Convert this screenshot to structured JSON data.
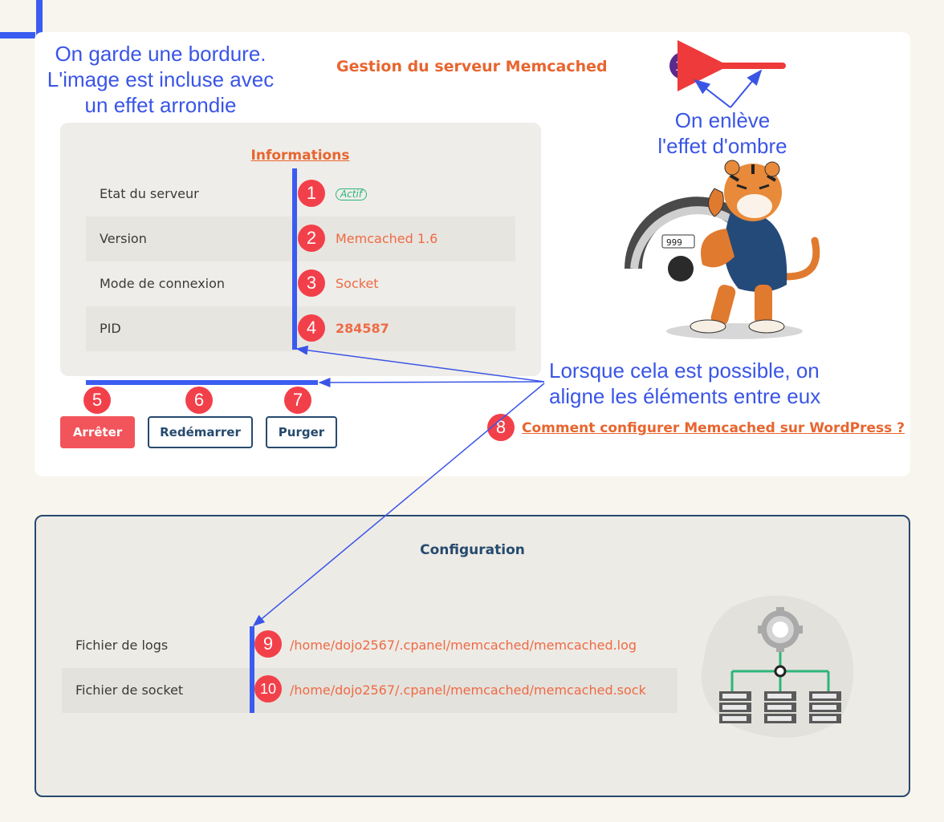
{
  "page": {
    "title": "Gestion du serveur Memcached",
    "info_title": "Informations",
    "config_title": "Configuration",
    "help_link": "Comment configurer Memcached sur WordPress ?"
  },
  "info_rows": [
    {
      "label": "Etat du serveur",
      "value": "Actif"
    },
    {
      "label": "Version",
      "value": "Memcached 1.6"
    },
    {
      "label": "Mode de connexion",
      "value": "Socket"
    },
    {
      "label": "PID",
      "value": "284587"
    }
  ],
  "buttons": {
    "stop": "Arrêter",
    "restart": "Redémarrer",
    "purge": "Purger"
  },
  "config_rows": [
    {
      "label": "Fichier de logs",
      "value": "/home/dojo2567/.cpanel/memcached/memcached.log"
    },
    {
      "label": "Fichier de socket",
      "value": "/home/dojo2567/.cpanel/memcached/memcached.sock"
    }
  ],
  "markers": [
    "1",
    "2",
    "3",
    "4",
    "5",
    "6",
    "7",
    "8",
    "9",
    "10",
    "13"
  ],
  "annotations": {
    "border_line1": "On garde une bordure.",
    "border_line2": "L'image est incluse avec",
    "border_line3": "un effet arrondie",
    "shadow_line1": "On enlève",
    "shadow_line2": "l'effet d'ombre",
    "align_line1": "Lorsque cela est possible, on",
    "align_line2": "aligne les éléments entre eux"
  },
  "icons": {
    "mascot": "tiger-speedometer-illustration",
    "config": "gear-server-network-illustration"
  },
  "colors": {
    "accent": "#e8652f",
    "danger": "#f2545b",
    "navy": "#264a6e",
    "annotation_blue": "#3a55e6",
    "success": "#2cb57a"
  },
  "sketch_text": {
    "gauge_digits": "999"
  }
}
